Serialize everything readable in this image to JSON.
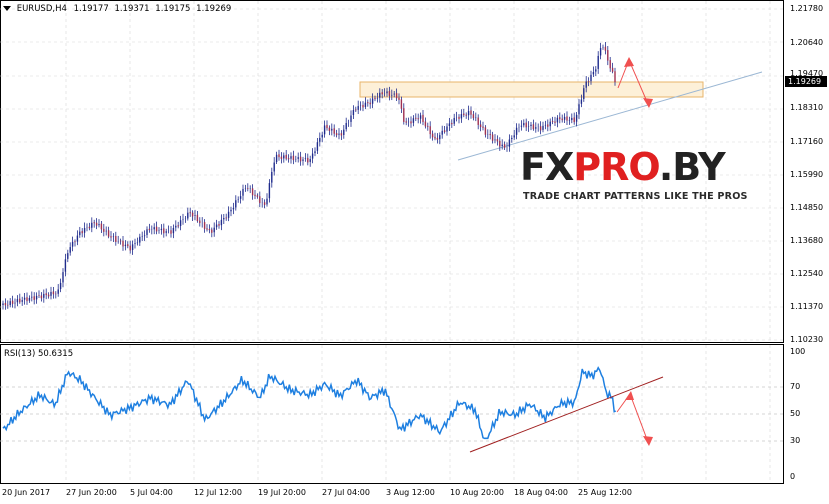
{
  "main_chart": {
    "header": {
      "arrow_icon": "triangle-down-icon",
      "symbol": "EURUSD,H4",
      "open": "1.19177",
      "high": "1.19371",
      "low": "1.19175",
      "close": "1.19269"
    },
    "current_price": "1.19269",
    "price_labels": [
      "1.21780",
      "1.20640",
      "1.19470",
      "1.18310",
      "1.17160",
      "1.15990",
      "1.14850",
      "1.13680",
      "1.12540",
      "1.11370",
      "1.10230"
    ]
  },
  "rsi_panel": {
    "label": "RSI(13) 50.6315",
    "levels": [
      "100",
      "70",
      "50",
      "30",
      "0"
    ]
  },
  "time_axis": {
    "labels": [
      "20 Jun 2017",
      "27 Jun 20:00",
      "5 Jul 04:00",
      "12 Jul 12:00",
      "19 Jul 20:00",
      "27 Jul 04:00",
      "3 Aug 12:00",
      "10 Aug 20:00",
      "18 Aug 04:00",
      "25 Aug 12:00"
    ]
  },
  "watermark": {
    "brand": "FXPRO.BY",
    "brand_fx": "FX",
    "brand_pro": "PRO",
    "brand_by": ".BY",
    "tagline": "TRADE CHART PATTERNS LIKE THE PROS"
  },
  "colors": {
    "candle": "#1f2b8c",
    "rsi_line": "#1e7fe0",
    "trendline_price": "#9bb7d4",
    "trendline_rsi": "#a02020",
    "zone_fill": "#fdf0d8",
    "zone_border": "#e8b46a",
    "arrow": "#f05050",
    "grid": "#d8d8d8",
    "logo_dark": "#222222",
    "logo_red": "#e02020"
  }
}
